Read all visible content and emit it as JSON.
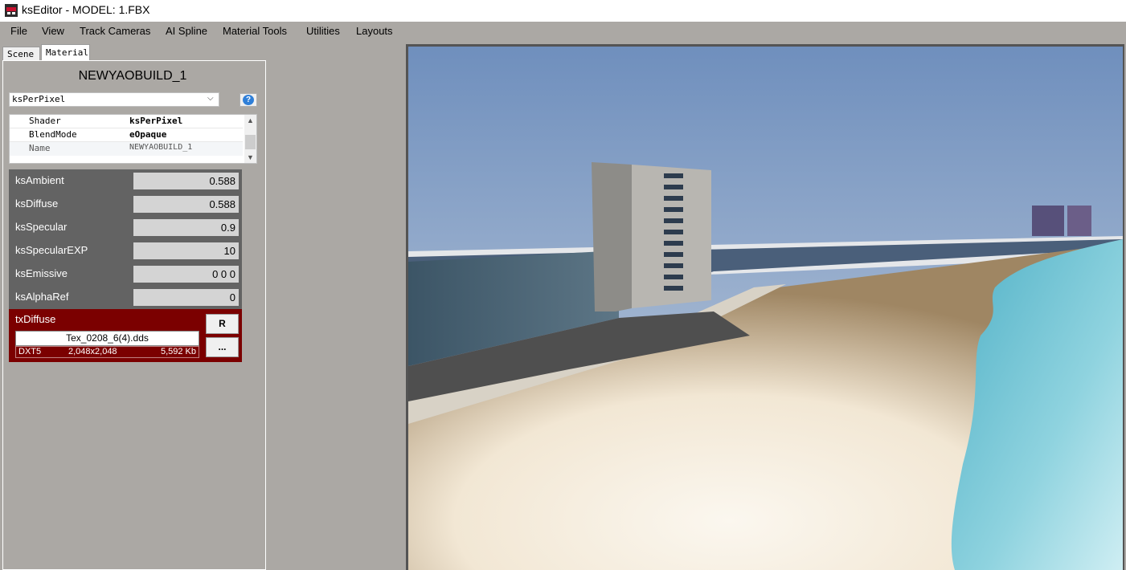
{
  "window": {
    "title": "ksEditor - MODEL: 1.FBX"
  },
  "menu": {
    "items": [
      "File",
      "View",
      "Track Cameras",
      "AI Spline",
      "Material Tools",
      "Utilities",
      "Layouts"
    ]
  },
  "tabs": {
    "scene": "Scene",
    "material": "Material",
    "active": "Material"
  },
  "material": {
    "name": "NEWYAOBUILD_1",
    "shader_select": "ksPerPixel",
    "properties": [
      {
        "key": "Shader",
        "value": "ksPerPixel"
      },
      {
        "key": "BlendMode",
        "value": "eOpaque"
      },
      {
        "key": "Name",
        "value": "NEWYAOBUILD_1"
      }
    ],
    "params": [
      {
        "label": "ksAmbient",
        "value": "0.588"
      },
      {
        "label": "ksDiffuse",
        "value": "0.588"
      },
      {
        "label": "ksSpecular",
        "value": "0.9"
      },
      {
        "label": "ksSpecularEXP",
        "value": "10"
      },
      {
        "label": "ksEmissive",
        "value": "0 0 0"
      },
      {
        "label": "ksAlphaRef",
        "value": "0"
      }
    ],
    "texture": {
      "label": "txDiffuse",
      "file": "Tex_0208_6(4).dds",
      "format": "DXT5",
      "dimensions": "2,048x2,048",
      "size": "5,592 Kb",
      "reload_button": "R",
      "browse_button": "..."
    }
  },
  "icons": {
    "app": "ks-app-icon",
    "help": "help-icon",
    "dropdown": "chevron-down-icon"
  },
  "colors": {
    "texture_block": "#7b0000",
    "param_row": "#636363",
    "panel_bg": "#aba8a4"
  }
}
